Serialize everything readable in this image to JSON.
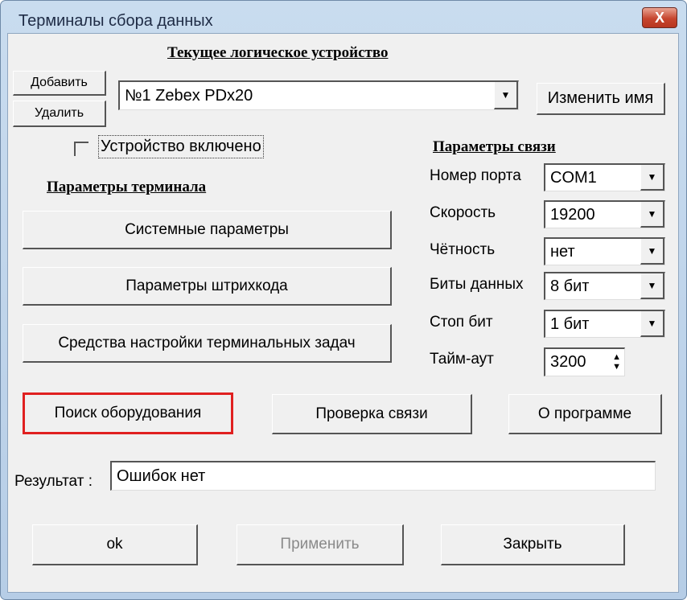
{
  "window": {
    "title": "Терминалы сбора данных",
    "close_label": "X"
  },
  "device": {
    "heading": "Текущее логическое устройство",
    "add": "Добавить",
    "remove": "Удалить",
    "selected": "№1 Zebex PDx20",
    "rename": "Изменить имя",
    "enabled_label": "Устройство включено",
    "enabled": false
  },
  "terminal": {
    "heading": "Параметры терминала",
    "system": "Системные параметры",
    "barcode": "Параметры штрихкода",
    "tasks": "Средства настройки терминальных задач"
  },
  "comm": {
    "heading": "Параметры связи",
    "fields": [
      {
        "label": "Номер порта",
        "value": "COM1"
      },
      {
        "label": "Скорость",
        "value": "19200"
      },
      {
        "label": "Чётность",
        "value": "нет"
      },
      {
        "label": "Биты данных",
        "value": "8 бит"
      },
      {
        "label": "Стоп бит",
        "value": "1 бит"
      }
    ],
    "timeout": {
      "label": "Тайм-аут",
      "value": "3200"
    }
  },
  "actions": {
    "search": "Поиск оборудования",
    "check": "Проверка связи",
    "about": "О программе"
  },
  "result": {
    "label": "Результат :",
    "value": "Ошибок нет"
  },
  "footer": {
    "ok": "ok",
    "apply": "Применить",
    "close": "Закрыть"
  },
  "colors": {
    "highlight": "#e02020",
    "disabled_text": "#8a8a8a"
  }
}
